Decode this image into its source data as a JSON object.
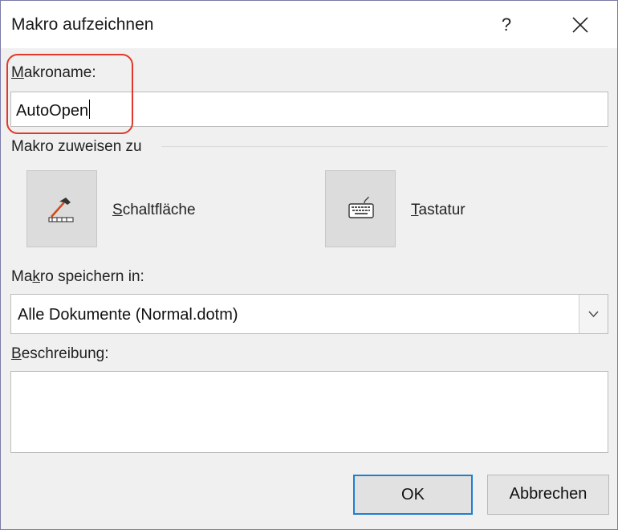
{
  "window": {
    "title": "Makro aufzeichnen",
    "help_label": "?",
    "close_label": "✕"
  },
  "macro_name": {
    "label_hotkey": "M",
    "label_rest": "akroname:",
    "value": "AutoOpen"
  },
  "assign": {
    "group_label": "Makro zuweisen zu",
    "button": {
      "label_hotkey": "S",
      "label_rest": "chaltfläche",
      "icon": "hammer-toolbar-icon"
    },
    "keyboard": {
      "label_hotkey": "T",
      "label_rest": "astatur",
      "icon": "keyboard-icon"
    }
  },
  "store_in": {
    "label_pre": "Ma",
    "label_hotkey": "k",
    "label_rest": "ro speichern in:",
    "selected": "Alle Dokumente (Normal.dotm)"
  },
  "description": {
    "label_hotkey": "B",
    "label_rest": "eschreibung:",
    "value": ""
  },
  "buttons": {
    "ok": "OK",
    "cancel": "Abbrechen"
  },
  "colors": {
    "highlight": "#e0392b",
    "default_button_border": "#1e7fd2"
  }
}
